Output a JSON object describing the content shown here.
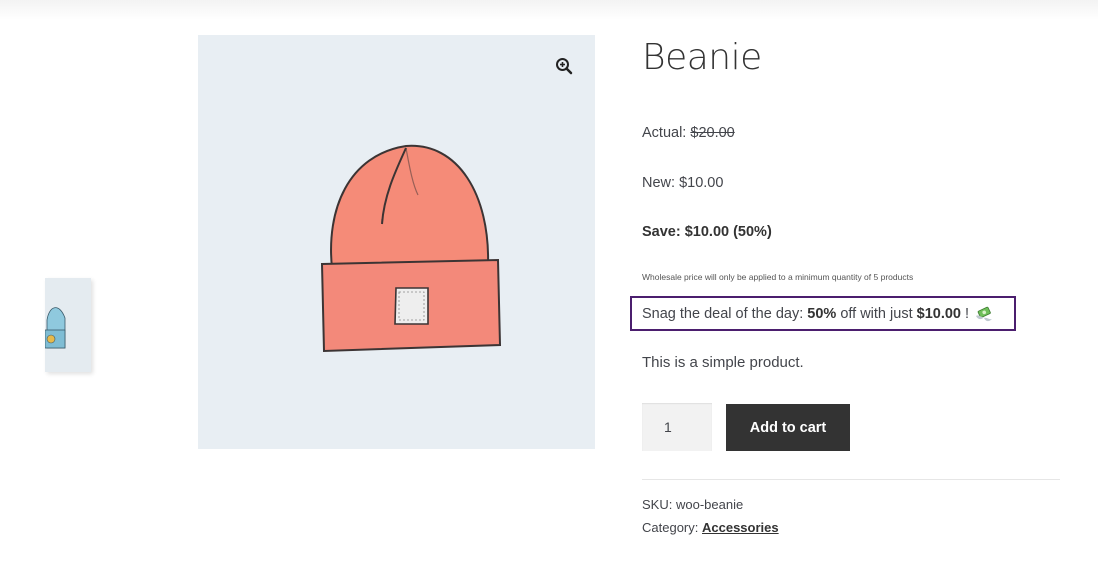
{
  "product": {
    "title": "Beanie",
    "actual_label": "Actual:",
    "actual_price": "$20.00",
    "new_label": "New:",
    "new_price": "$10.00",
    "save_text": "Save: $10.00 (50%)",
    "wholesale_note": "Wholesale price will only be applied to a minimum quantity of 5 products",
    "deal": {
      "prefix": "Snag the deal of the day: ",
      "percent": "50%",
      "middle": " off with just ",
      "price": "$10.00",
      "suffix": " !",
      "emoji_icon": "money-with-wings-icon"
    },
    "description": "This is a simple product.",
    "quantity": "1",
    "add_to_cart_label": "Add to cart",
    "sku_label": "SKU:",
    "sku_value": "woo-beanie",
    "category_label": "Category:",
    "category_value": "Accessories"
  },
  "gallery": {
    "zoom_icon": "zoom-in-icon",
    "main_image_color": "#f28b7c",
    "thumbnail_color": "#7fc4de"
  }
}
